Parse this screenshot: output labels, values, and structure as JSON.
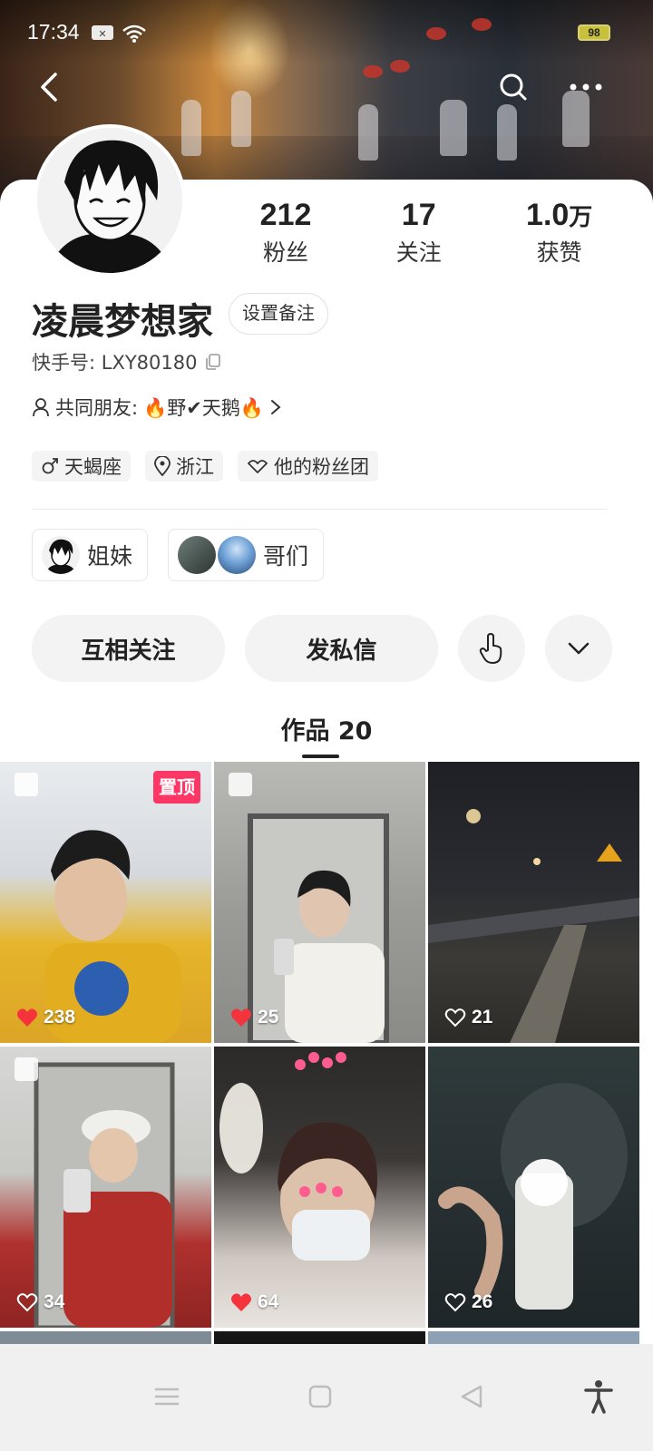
{
  "status": {
    "time": "17:34",
    "battery": "98"
  },
  "profile": {
    "name": "凌晨梦想家",
    "remark_button": "设置备注",
    "kuaishou_id": "快手号: LXY80180",
    "mutual_label": "共同朋友:",
    "mutual_names": "🔥野✔天鹅🔥",
    "stats": [
      {
        "value": "212",
        "unit": "",
        "label": "粉丝"
      },
      {
        "value": "17",
        "unit": "",
        "label": "关注"
      },
      {
        "value": "1.0",
        "unit": "万",
        "label": "获赞"
      }
    ],
    "tags": [
      {
        "icon": "male-icon",
        "label": "天蝎座"
      },
      {
        "icon": "location-icon",
        "label": "浙江"
      },
      {
        "icon": "fan-club-icon",
        "label": "他的粉丝团"
      }
    ],
    "groups": [
      {
        "label": "姐妹"
      },
      {
        "label": "哥们"
      }
    ],
    "actions": {
      "follow_back": "互相关注",
      "message": "发私信"
    }
  },
  "tabs": {
    "works": "作品 20"
  },
  "works": [
    {
      "likes": "238",
      "liked": true,
      "pinned": true,
      "pin_label": "置顶",
      "image_icon": true
    },
    {
      "likes": "25",
      "liked": true,
      "pinned": false,
      "image_icon": true
    },
    {
      "likes": "21",
      "liked": false,
      "pinned": false,
      "image_icon": false
    },
    {
      "likes": "34",
      "liked": false,
      "pinned": false,
      "image_icon": true
    },
    {
      "likes": "64",
      "liked": true,
      "pinned": false,
      "image_icon": false
    },
    {
      "likes": "26",
      "liked": false,
      "pinned": false,
      "image_icon": false
    }
  ],
  "colors": {
    "accent_red": "#fe3666",
    "heart_red": "#f4333c",
    "pill_bg": "#f3f3f3"
  }
}
